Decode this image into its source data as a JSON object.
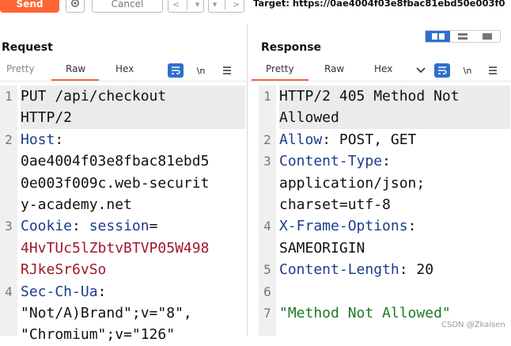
{
  "toolbar": {
    "send_label": "Send",
    "cancel_label": "Cancel",
    "back_label": "<",
    "forward_label": ">",
    "dropdown_label": "▾",
    "target_text": "Target: https://0ae4004f03e8fbac81ebd50e003f0"
  },
  "request": {
    "title": "Request",
    "tabs": [
      "Pretty",
      "Raw",
      "Hex"
    ],
    "active_tab": "Raw",
    "newline_label": "\\n",
    "lines": [
      {
        "num": "1",
        "parts": [
          {
            "t": "PUT /api/checkout",
            "c": "plain"
          }
        ]
      },
      {
        "num": "",
        "parts": [
          {
            "t": "HTTP/2",
            "c": "plain"
          }
        ]
      },
      {
        "num": "2",
        "parts": [
          {
            "t": "Host",
            "c": "k"
          },
          {
            "t": ":",
            "c": "plain"
          }
        ]
      },
      {
        "num": "",
        "parts": [
          {
            "t": "0ae4004f03e8fbac81ebd5",
            "c": "plain"
          }
        ]
      },
      {
        "num": "",
        "parts": [
          {
            "t": "0e003f009c.web-securit",
            "c": "plain"
          }
        ]
      },
      {
        "num": "",
        "parts": [
          {
            "t": "y-academy.net",
            "c": "plain"
          }
        ]
      },
      {
        "num": "3",
        "parts": [
          {
            "t": "Cookie",
            "c": "k"
          },
          {
            "t": ": ",
            "c": "plain"
          },
          {
            "t": "session",
            "c": "k"
          },
          {
            "t": "=",
            "c": "plain"
          }
        ]
      },
      {
        "num": "",
        "parts": [
          {
            "t": "4HvTUc5lZbtvBTVP05W498",
            "c": "cv"
          }
        ]
      },
      {
        "num": "",
        "parts": [
          {
            "t": "RJkeSr6vSo",
            "c": "cv"
          }
        ]
      },
      {
        "num": "4",
        "parts": [
          {
            "t": "Sec-Ch-Ua",
            "c": "k"
          },
          {
            "t": ":",
            "c": "plain"
          }
        ]
      },
      {
        "num": "",
        "parts": [
          {
            "t": "\"Not/A)Brand\";v=\"8\",",
            "c": "plain"
          }
        ]
      },
      {
        "num": "",
        "parts": [
          {
            "t": "\"Chromium\";v=\"126\"",
            "c": "plain"
          }
        ]
      }
    ]
  },
  "response": {
    "title": "Response",
    "tabs": [
      "Pretty",
      "Raw",
      "Hex"
    ],
    "active_tab": "Pretty",
    "newline_label": "\\n",
    "lines": [
      {
        "num": "1",
        "parts": [
          {
            "t": "HTTP/2 405 Method Not",
            "c": "plain"
          }
        ]
      },
      {
        "num": "",
        "parts": [
          {
            "t": "Allowed",
            "c": "plain"
          }
        ]
      },
      {
        "num": "2",
        "parts": [
          {
            "t": "Allow",
            "c": "k"
          },
          {
            "t": ": POST, GET",
            "c": "plain"
          }
        ]
      },
      {
        "num": "3",
        "parts": [
          {
            "t": "Content-Type",
            "c": "k"
          },
          {
            "t": ":",
            "c": "plain"
          }
        ]
      },
      {
        "num": "",
        "parts": [
          {
            "t": "application/json;",
            "c": "plain"
          }
        ]
      },
      {
        "num": "",
        "parts": [
          {
            "t": "charset=utf-8",
            "c": "plain"
          }
        ]
      },
      {
        "num": "4",
        "parts": [
          {
            "t": "X-Frame-Options",
            "c": "k"
          },
          {
            "t": ":",
            "c": "plain"
          }
        ]
      },
      {
        "num": "",
        "parts": [
          {
            "t": "SAMEORIGIN",
            "c": "plain"
          }
        ]
      },
      {
        "num": "5",
        "parts": [
          {
            "t": "Content-Length",
            "c": "k"
          },
          {
            "t": ": 20",
            "c": "plain"
          }
        ]
      },
      {
        "num": "6",
        "parts": [
          {
            "t": "",
            "c": "plain"
          }
        ]
      },
      {
        "num": "7",
        "parts": [
          {
            "t": "\"Method Not Allowed\"",
            "c": "str"
          }
        ]
      }
    ]
  },
  "watermark": "CSDN @Zkaisen",
  "colors": {
    "accent": "#ff6633",
    "toggle_blue": "#2f6fcf",
    "key": "#1a3d8f",
    "cookie": "#a0182a",
    "string": "#1a7a2a"
  }
}
